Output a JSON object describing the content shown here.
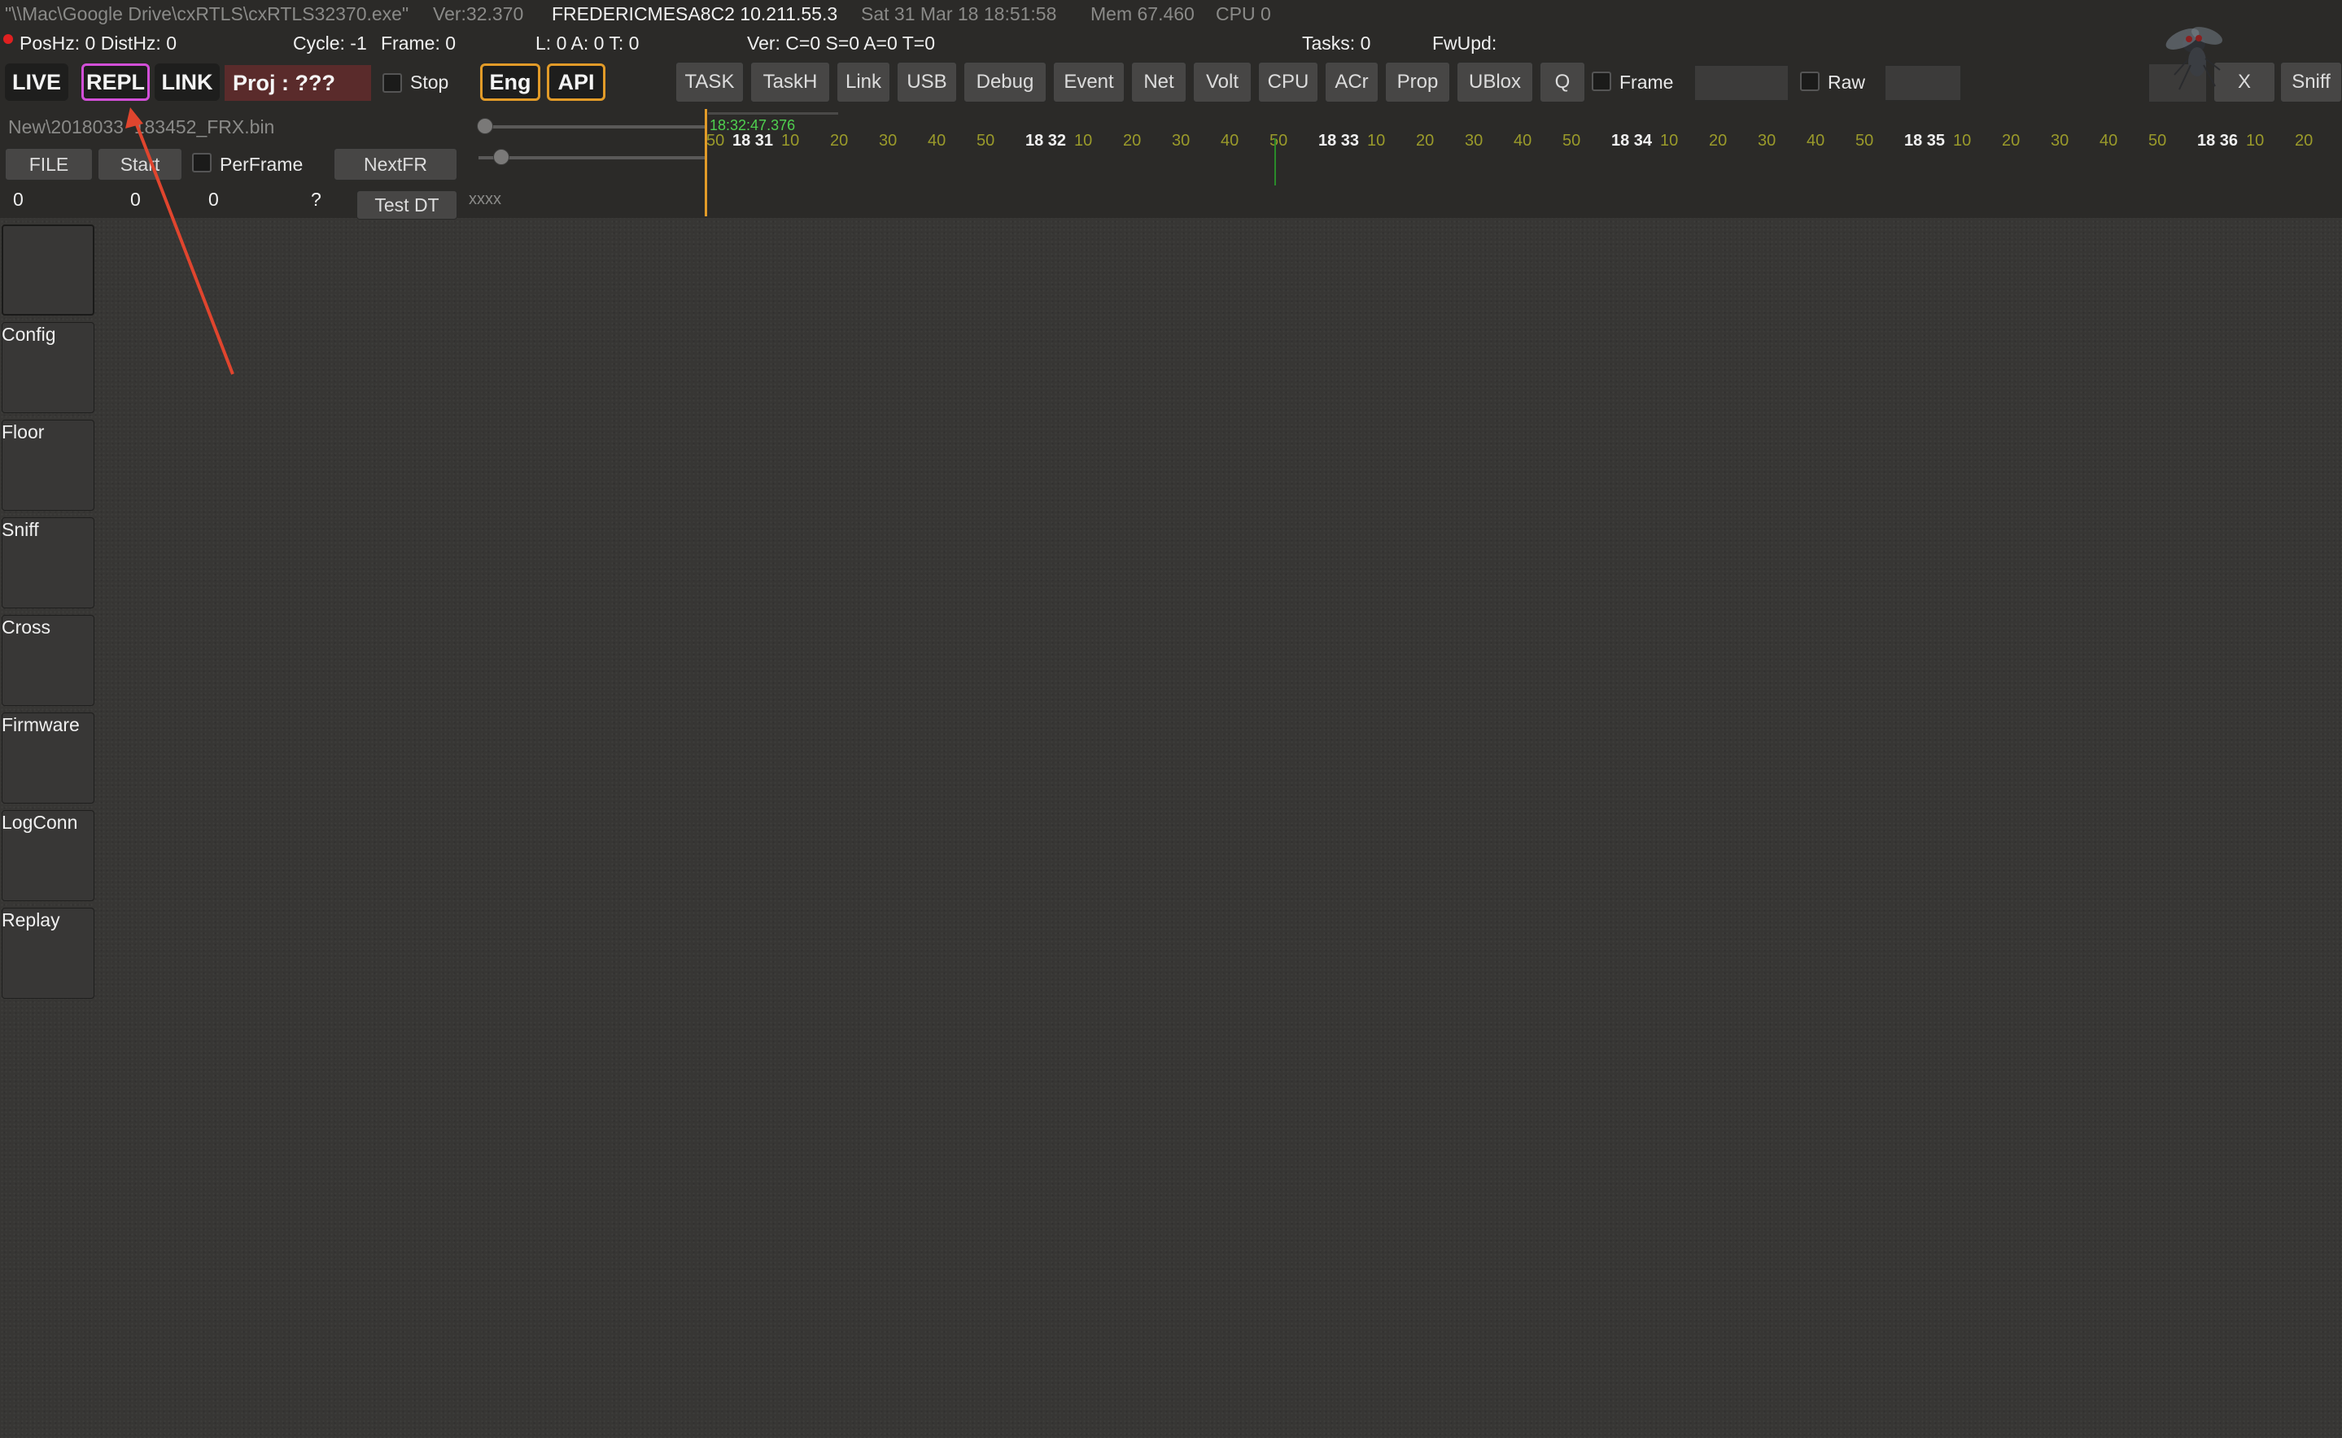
{
  "status": {
    "path": "\"\\\\Mac\\Google Drive\\cxRTLS\\cxRTLS32370.exe\"",
    "version": "Ver:32.370",
    "host": "FREDERICMESA8C2 10.211.55.3",
    "datetime": "Sat 31 Mar 18 18:51:58",
    "mem": "Mem 67.460",
    "cpu": "CPU 0",
    "poshz": "PosHz: 0 DistHz: 0",
    "cycle": "Cycle: -1",
    "frame": "Frame: 0",
    "lat": "L: 0  A: 0  T: 0",
    "ver_counts": "Ver: C=0 S=0 A=0 T=0",
    "tasks": "Tasks: 0",
    "fwupd": "FwUpd:"
  },
  "modes": {
    "live": "LIVE",
    "repl": "REPL",
    "link": "LINK",
    "proj": "Proj : ???",
    "stop": "Stop",
    "eng": "Eng",
    "api": "API"
  },
  "toolbar": {
    "buttons": [
      "TASK",
      "TaskH",
      "Link",
      "USB",
      "Debug",
      "Event",
      "Net",
      "Volt",
      "CPU",
      "ACr",
      "Prop",
      "UBlox",
      "Q"
    ],
    "frame_label": "Frame",
    "raw_label": "Raw",
    "x_label": "X",
    "sniff_label": "Sniff"
  },
  "replay": {
    "file_name": "New\\2018033  183452_FRX.bin",
    "file_btn": "FILE",
    "start_btn": "Start",
    "perframe_label": "PerFrame",
    "nextfr_btn": "NextFR",
    "testdt_btn": "Test DT",
    "counter1": "0",
    "counter2": "0",
    "counter3": "0",
    "question": "?",
    "xxxx": "xxxx"
  },
  "timeline": {
    "cursor_time": "18:32:47.376",
    "minutes": [
      "18 31",
      "18 32",
      "18 33",
      "18 34",
      "18 35",
      "18 36"
    ],
    "seconds": [
      "10",
      "20",
      "30",
      "40",
      "50"
    ],
    "lead_label": "50"
  },
  "sidebar": {
    "items": [
      "Config",
      "Floor",
      "Sniff",
      "Cross",
      "Firmware",
      "LogConn",
      "Replay"
    ]
  },
  "colors": {
    "background": "#373634",
    "repl_border": "#d24fd8",
    "orange_accent": "#e29b28",
    "proj_bg": "#5a2b2b",
    "cursor_time": "#4fd04f",
    "timeline_sub": "#9a9a2a",
    "annotation_arrow": "#e0452e"
  }
}
